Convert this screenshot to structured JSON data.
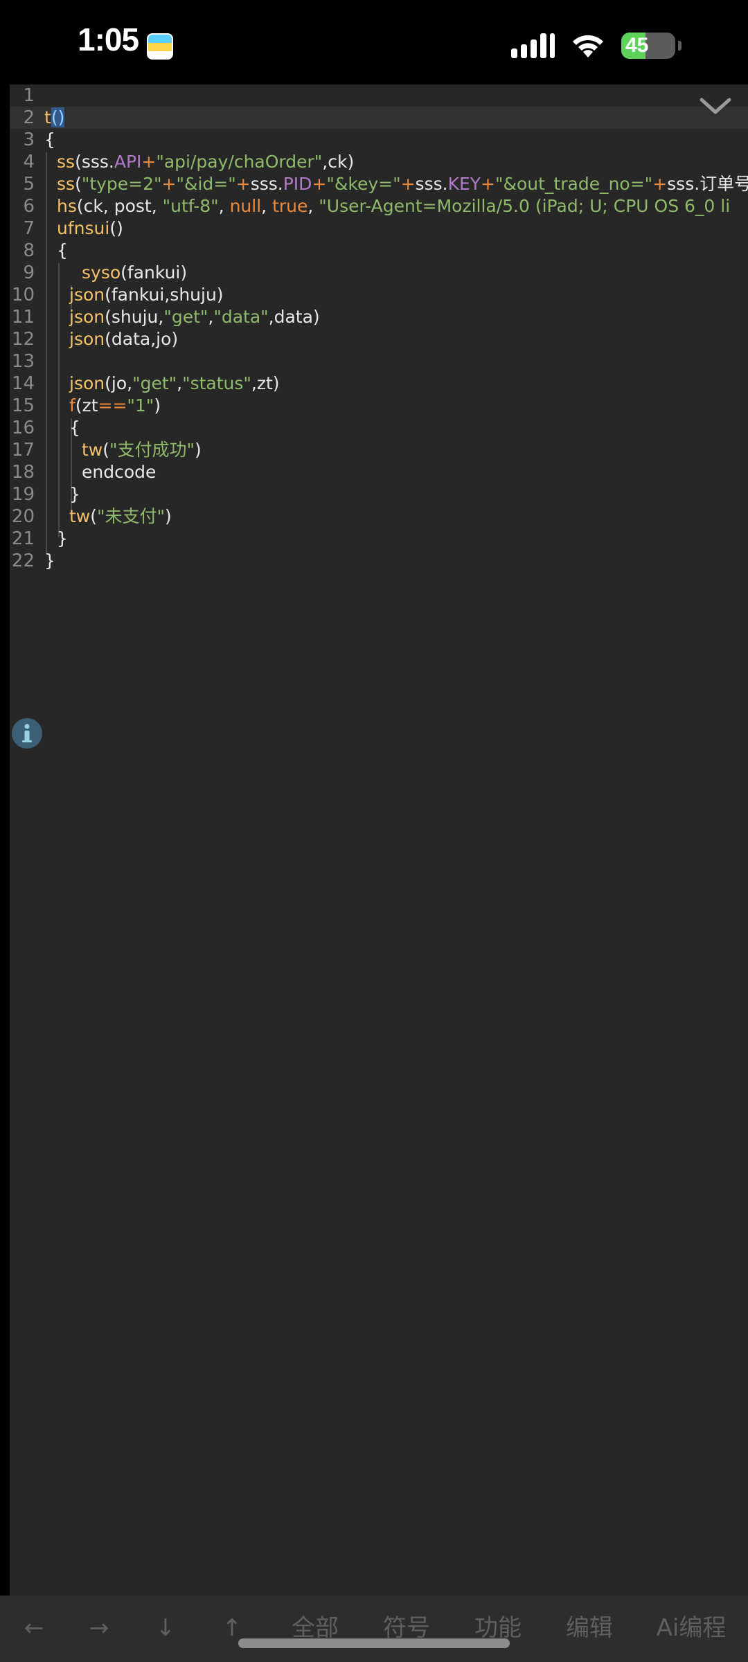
{
  "status_bar": {
    "time": "1:05",
    "battery_level": "45",
    "battery_fraction": 0.45,
    "icons": [
      "app-icon",
      "signal-icon",
      "wifi-icon",
      "battery-icon"
    ]
  },
  "editor": {
    "line_numbers": [
      "1",
      "2",
      "3",
      "4",
      "5",
      "6",
      "7",
      "8",
      "9",
      "10",
      "11",
      "12",
      "13",
      "14",
      "15",
      "16",
      "17",
      "18",
      "19",
      "20",
      "21",
      "22"
    ],
    "collapse_icon": "chevron-down-icon",
    "info_icon": "info-icon",
    "colors": {
      "background": "#272727",
      "function": "#f5c06a",
      "string": "#8fba6a",
      "property": "#b07ac8",
      "keyword": "#ec8a3a"
    },
    "code": {
      "l2": {
        "fn": "t",
        "paren": "()"
      },
      "l3": {
        "brace": "{"
      },
      "l4": {
        "fn": "ss",
        "a": "(sss.",
        "prop": "API",
        "plus": "+",
        "str": "\"api/pay/chaOrder\"",
        "b": ",ck)"
      },
      "l5": {
        "fn": "ss",
        "a": "(",
        "s1": "\"type=2\"",
        "p1": "+",
        "s2": "\"&id=\"",
        "p2": "+",
        "a2": "sss.",
        "prop1": "PID",
        "p3": "+",
        "s3": "\"&key=\"",
        "p4": "+",
        "a3": "sss.",
        "prop2": "KEY",
        "p5": "+",
        "s4": "\"&out_trade_no=\"",
        "p6": "+",
        "a4": "sss.",
        "tail": "订单号,p"
      },
      "l6": {
        "fn": "hs",
        "a": "(ck, post, ",
        "s1": "\"utf-8\"",
        "b": ", ",
        "k1": "null",
        "c": ", ",
        "k2": "true",
        "d": ", ",
        "s2": "\"User-Agent=Mozilla/5.0 (iPad; U; CPU OS 6_0 li"
      },
      "l7": {
        "fn": "ufnsui",
        "a": "()"
      },
      "l8": {
        "brace": "{"
      },
      "l9": {
        "fn": "syso",
        "a": "(fankui)"
      },
      "l10": {
        "fn": "json",
        "a": "(fankui,shuju)"
      },
      "l11": {
        "fn": "json",
        "a": "(shuju,",
        "s1": "\"get\"",
        "b": ",",
        "s2": "\"data\"",
        "c": ",data)"
      },
      "l12": {
        "fn": "json",
        "a": "(data,jo)"
      },
      "l14": {
        "fn": "json",
        "a": "(jo,",
        "s1": "\"get\"",
        "b": ",",
        "s2": "\"status\"",
        "c": ",zt)"
      },
      "l15": {
        "kw": "f",
        "a": "(zt",
        "op": "==",
        "s1": "\"1\"",
        "b": ")"
      },
      "l16": {
        "brace": "{"
      },
      "l17": {
        "fn": "tw",
        "a": "(",
        "s1": "\"支付成功\"",
        "b": ")"
      },
      "l18": {
        "text": "endcode"
      },
      "l19": {
        "brace": "}"
      },
      "l20": {
        "fn": "tw",
        "a": "(",
        "s1": "\"未支付\"",
        "b": ")"
      },
      "l21": {
        "brace": "}"
      },
      "l22": {
        "brace": "}"
      }
    }
  },
  "toolbar": {
    "left_arrow": "←",
    "right_arrow": "→",
    "down_arrow": "↓",
    "up_arrow": "↑",
    "all": "全部",
    "symbols": "符号",
    "functions": "功能",
    "edit": "编辑",
    "ai": "Ai编程"
  }
}
